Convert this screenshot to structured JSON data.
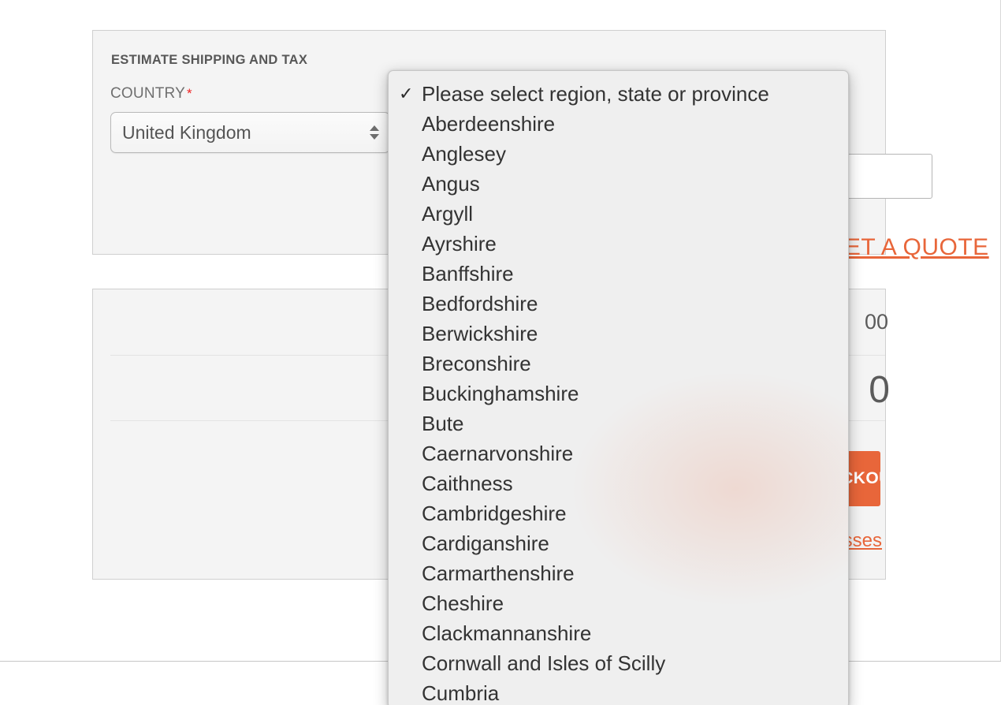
{
  "estimate_card": {
    "title": "ESTIMATE SHIPPING AND TAX",
    "country_label": "COUNTRY",
    "required_marker": "*",
    "country_value": "United Kingdom",
    "zip_value": "",
    "zip_placeholder": "",
    "quote_link": "GET A QUOTE"
  },
  "summary_card": {
    "subtotal_amount": "00",
    "total_amount": "0",
    "checkout_label": "PROCEED TO CHECKOUT",
    "methods_link": "Check Out with Multiple Addresses"
  },
  "region_dropdown": {
    "selected": "Please select region, state or province",
    "checkmark": "✓",
    "options": [
      "Please select region, state or province",
      "Aberdeenshire",
      "Anglesey",
      "Angus",
      "Argyll",
      "Ayrshire",
      "Banffshire",
      "Bedfordshire",
      "Berwickshire",
      "Breconshire",
      "Buckinghamshire",
      "Bute",
      "Caernarvonshire",
      "Caithness",
      "Cambridgeshire",
      "Cardiganshire",
      "Carmarthenshire",
      "Cheshire",
      "Clackmannanshire",
      "Cornwall and Isles of Scilly",
      "Cumbria"
    ]
  },
  "colors": {
    "accent_orange": "#e8663a",
    "required_red": "#ee2222",
    "card_bg": "#f4f4f4",
    "popup_bg": "#efefef"
  }
}
